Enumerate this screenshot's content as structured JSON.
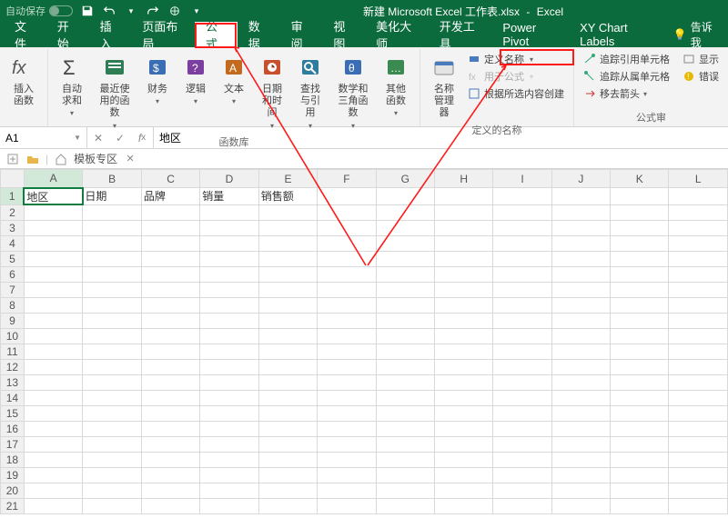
{
  "titlebar": {
    "autosave_label": "自动保存",
    "filename": "新建 Microsoft Excel 工作表.xlsx",
    "appname": "Excel"
  },
  "menu": {
    "file": "文件",
    "home": "开始",
    "insert": "插入",
    "pagelayout": "页面布局",
    "formulas": "公式",
    "data": "数据",
    "review": "审阅",
    "view": "视图",
    "beautify": "美化大师",
    "developer": "开发工具",
    "powerpivot": "Power Pivot",
    "xychart": "XY Chart Labels",
    "tellme": "告诉我"
  },
  "ribbon": {
    "insertfn": "插入函数",
    "autosum": "自动求和",
    "recent": "最近使用的函数",
    "financial": "财务",
    "logical": "逻辑",
    "text": "文本",
    "datetime": "日期和时间",
    "lookup": "查找与引用",
    "math": "数学和三角函数",
    "more": "其他函数",
    "group_fnlib": "函数库",
    "namemgr": "名称管理器",
    "definename": "定义名称",
    "useformula": "用于公式",
    "createfromsel": "根据所选内容创建",
    "group_names": "定义的名称",
    "traceprec": "追踪引用单元格",
    "tracedep": "追踪从属单元格",
    "removearrow": "移去箭头",
    "showformula": "显示",
    "errorcheck": "错误",
    "group_audit": "公式审"
  },
  "namebox": {
    "value": "A1"
  },
  "formula": {
    "value": "地区"
  },
  "tabstrip": {
    "templates": "模板专区"
  },
  "columns": [
    "A",
    "B",
    "C",
    "D",
    "E",
    "F",
    "G",
    "H",
    "I",
    "J",
    "K",
    "L"
  ],
  "rows": 21,
  "data": {
    "r1": {
      "A": "地区",
      "B": "日期",
      "C": "品牌",
      "D": "销量",
      "E": "销售额"
    }
  },
  "active_cell": "A1"
}
